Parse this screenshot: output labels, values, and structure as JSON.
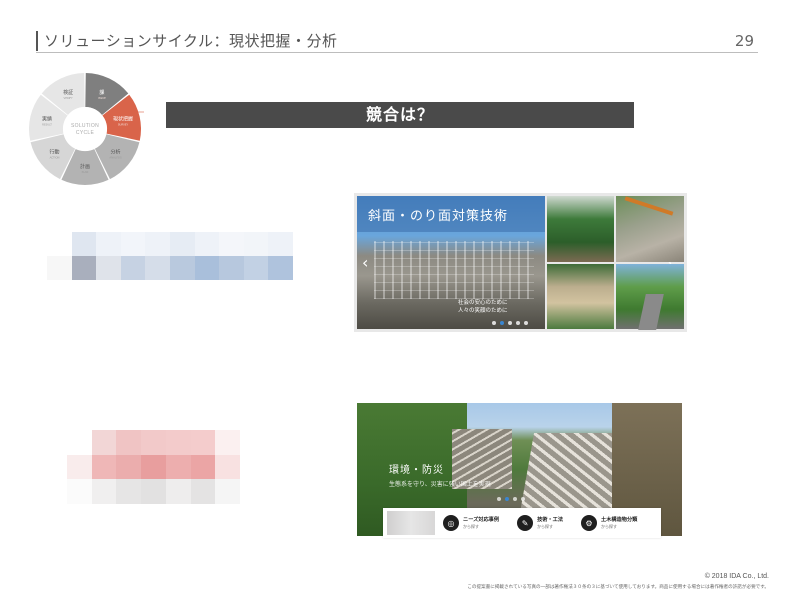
{
  "header": {
    "title": "ソリューションサイクル：現状把握・分析",
    "page_number": "29"
  },
  "cycle": {
    "center_line1": "SOLUTION",
    "center_line2": "CYCLE",
    "segments": [
      {
        "label": "課",
        "sub": "ISSUE"
      },
      {
        "label": "現状把握",
        "sub": "SURVEY"
      },
      {
        "label": "分析",
        "sub": "ANALYSIS"
      },
      {
        "label": "計画",
        "sub": "PLAN"
      },
      {
        "label": "行動",
        "sub": "ACTION"
      },
      {
        "label": "実績",
        "sub": "RESULT"
      },
      {
        "label": "検証",
        "sub": "VERIFY"
      }
    ],
    "colors": {
      "active": "#d9644a",
      "dark": "#7f7f7f",
      "mid": "#b3b3b3",
      "light": "#d6d6d6",
      "lighter": "#e6e6e6"
    }
  },
  "banner": {
    "text": "競合は？",
    "color": "#4a4a4a"
  },
  "mosaic_top": {
    "colors": [
      "#ffffff",
      "#dfe6f0",
      "#eef2f8",
      "#f2f5fa",
      "#eef2f8",
      "#e6ecf4",
      "#eef2f8",
      "#f4f6fa",
      "#f2f5f9",
      "#eef2f8",
      "#f7f7f7",
      "#a9afbd",
      "#dfe3ea",
      "#c6d2e3",
      "#d5dde9",
      "#b9c9de",
      "#a9bfdb",
      "#b7c8de",
      "#c2d1e4",
      "#afc3dd"
    ]
  },
  "mosaic_bottom": {
    "colors": [
      "#ffffff",
      "#f2d6d6",
      "#f0c4c4",
      "#f2c9c9",
      "#f3cbcb",
      "#f4cccc",
      "#fbf0f0",
      "#f9ecec",
      "#efb7b7",
      "#ebadad",
      "#e89e9e",
      "#edaeae",
      "#eba5a5",
      "#f8e1e1",
      "#fbfbfb",
      "#f0efef",
      "#e6e5e5",
      "#e2e1e1",
      "#eeeded",
      "#e4e3e3",
      "#f5f5f5"
    ]
  },
  "screenshot1": {
    "sign_text": "斜面・のり面対策技術",
    "caption_line1": "社会の安心のために",
    "caption_line2": "人々の笑顔のために",
    "arrow_left": "‹",
    "arrow_right": "›"
  },
  "screenshot2": {
    "overlay_big": "環境・防災",
    "overlay_small": "生態系を守り、災害に強い国土を実現",
    "nav": [
      {
        "icon": "◎",
        "line1": "ニーズ対応事例",
        "line2": "から探す"
      },
      {
        "icon": "✎",
        "line1": "技術・工法",
        "line2": "から探す"
      },
      {
        "icon": "⚙",
        "line1": "土木構造物分類",
        "line2": "から探す"
      }
    ]
  },
  "footer": {
    "copyright": "© 2018 IDA Co., Ltd.",
    "disclaimer": "この提案書に掲載されている写真の一部は著作権法３０条の３に基づいて使用しております。商品に使用する場合には著作権者の許諾が必要です。"
  }
}
